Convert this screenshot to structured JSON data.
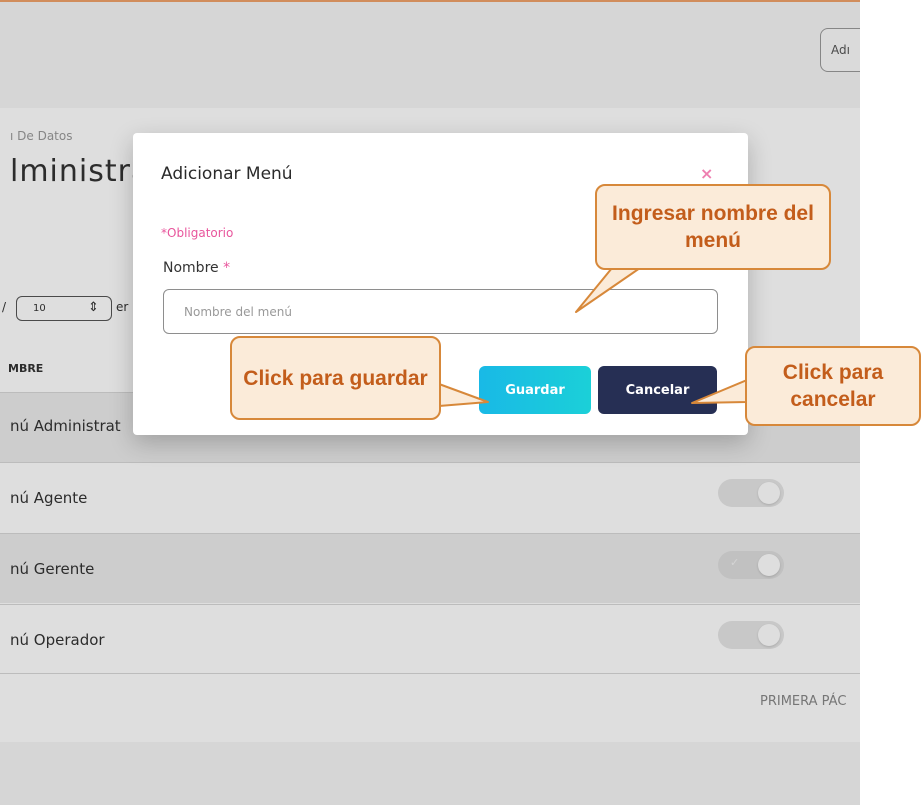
{
  "header": {
    "admin_button_label": "Adı"
  },
  "page": {
    "breadcrumb": "ı De Datos",
    "title": "lministra"
  },
  "table": {
    "page_size": "10",
    "page_size_suffix": "er",
    "page_size_prefix": "/",
    "column_header": "MBRE",
    "rows": [
      {
        "label": "nú Administrat"
      },
      {
        "label": "nú Agente"
      },
      {
        "label": "nú Gerente"
      },
      {
        "label": "nú Operador"
      }
    ],
    "pagination_first": "PRIMERA PÁC"
  },
  "modal": {
    "title": "Adicionar Menú",
    "close_symbol": "×",
    "required_note": "*Obligatorio",
    "name_label": "Nombre",
    "required_star": "*",
    "name_placeholder": "Nombre del menú",
    "name_value": "",
    "save_label": "Guardar",
    "cancel_label": "Cancelar"
  },
  "callouts": {
    "name_hint": "Ingresar nombre del menú",
    "save_hint": "Click para guardar",
    "cancel_hint": "Click para cancelar"
  },
  "colors": {
    "accent_orange": "#f0a36a",
    "callout_fill": "#fbebd9",
    "callout_border": "#d7883a",
    "callout_text": "#c35d1b",
    "save_button": "#19b9e6",
    "cancel_button": "#262f54",
    "required_pink": "#e8559c"
  }
}
